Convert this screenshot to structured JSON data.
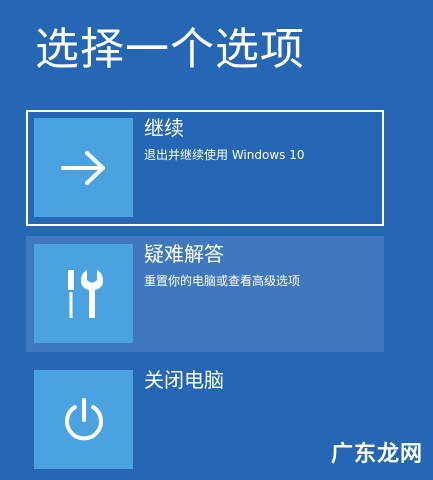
{
  "title": "选择一个选项",
  "options": [
    {
      "title": "继续",
      "description": "退出并继续使用 Windows 10",
      "icon": "arrow-right-icon"
    },
    {
      "title": "疑难解答",
      "description": "重置你的电脑或查看高级选项",
      "icon": "tools-icon"
    },
    {
      "title": "关闭电脑",
      "description": "",
      "icon": "power-icon"
    }
  ],
  "watermark": "广东龙网",
  "colors": {
    "background": "#2566b5",
    "tile": "#4aa3e0",
    "text": "#ffffff"
  }
}
